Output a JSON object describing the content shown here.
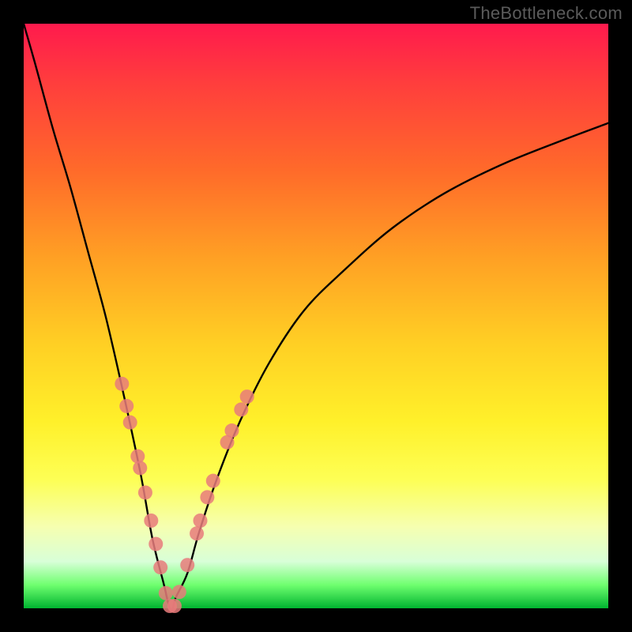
{
  "watermark": "TheBottleneck.com",
  "chart_data": {
    "type": "line",
    "title": "",
    "xlabel": "",
    "ylabel": "",
    "x_range": [
      0,
      1
    ],
    "y_range": [
      0,
      1
    ],
    "series": [
      {
        "name": "bottleneck-curve",
        "x": [
          0.0,
          0.02,
          0.05,
          0.08,
          0.11,
          0.14,
          0.17,
          0.2,
          0.22,
          0.24,
          0.245,
          0.25,
          0.255,
          0.26,
          0.28,
          0.3,
          0.33,
          0.37,
          0.42,
          0.48,
          0.55,
          0.63,
          0.72,
          0.82,
          0.92,
          1.0
        ],
        "y": [
          1.0,
          0.93,
          0.82,
          0.72,
          0.61,
          0.5,
          0.37,
          0.23,
          0.12,
          0.04,
          0.018,
          0.0,
          0.0,
          0.018,
          0.06,
          0.13,
          0.22,
          0.32,
          0.42,
          0.51,
          0.58,
          0.65,
          0.71,
          0.76,
          0.8,
          0.83
        ]
      }
    ],
    "markers": {
      "name": "highlight-dots",
      "color": "#e77b7b",
      "points": [
        {
          "x": 0.168,
          "y": 0.384
        },
        {
          "x": 0.176,
          "y": 0.346
        },
        {
          "x": 0.182,
          "y": 0.318
        },
        {
          "x": 0.195,
          "y": 0.26
        },
        {
          "x": 0.199,
          "y": 0.24
        },
        {
          "x": 0.208,
          "y": 0.198
        },
        {
          "x": 0.218,
          "y": 0.15
        },
        {
          "x": 0.226,
          "y": 0.11
        },
        {
          "x": 0.234,
          "y": 0.07
        },
        {
          "x": 0.243,
          "y": 0.026
        },
        {
          "x": 0.25,
          "y": 0.004
        },
        {
          "x": 0.258,
          "y": 0.004
        },
        {
          "x": 0.266,
          "y": 0.028
        },
        {
          "x": 0.28,
          "y": 0.074
        },
        {
          "x": 0.296,
          "y": 0.128
        },
        {
          "x": 0.302,
          "y": 0.15
        },
        {
          "x": 0.314,
          "y": 0.19
        },
        {
          "x": 0.324,
          "y": 0.218
        },
        {
          "x": 0.348,
          "y": 0.284
        },
        {
          "x": 0.356,
          "y": 0.304
        },
        {
          "x": 0.372,
          "y": 0.34
        },
        {
          "x": 0.382,
          "y": 0.362
        }
      ]
    }
  }
}
